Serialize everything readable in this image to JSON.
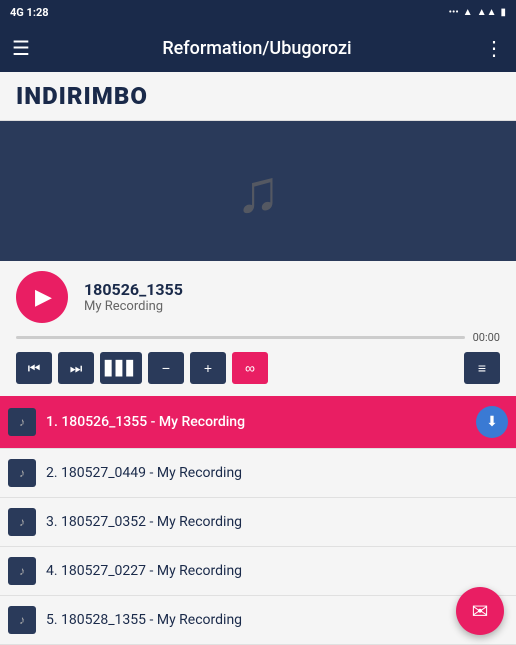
{
  "statusBar": {
    "left": "4G 1:28",
    "icons": [
      "...",
      "wifi",
      "signal",
      "battery"
    ]
  },
  "toolbar": {
    "title": "Reformation/Ubugorozi",
    "menuIcon": "☰",
    "moreIcon": "⋮"
  },
  "pageTitle": "INDIRIMBO",
  "player": {
    "trackName": "180526_1355",
    "trackSubtitle": "My Recording",
    "playButtonLabel": "▶",
    "time": "00:00",
    "progress": 0
  },
  "controls": {
    "prevLabel": "⏮",
    "nextLabel": "⏭",
    "equalizerLabel": "▋▋▋",
    "minusLabel": "−",
    "plusLabel": "+",
    "loopLabel": "∞",
    "playlistLabel": "≡♪"
  },
  "tracks": [
    {
      "id": 1,
      "label": "1. 180526_1355 - My Recording",
      "active": true,
      "showDownload": true
    },
    {
      "id": 2,
      "label": "2. 180527_0449 - My Recording",
      "active": false,
      "showDownload": false
    },
    {
      "id": 3,
      "label": "3. 180527_0352 - My Recording",
      "active": false,
      "showDownload": false
    },
    {
      "id": 4,
      "label": "4. 180527_0227 - My Recording",
      "active": false,
      "showDownload": false
    },
    {
      "id": 5,
      "label": "5. 180528_1355 - My Recording",
      "active": false,
      "showDownload": false
    }
  ],
  "fab": {
    "icon": "✉"
  }
}
